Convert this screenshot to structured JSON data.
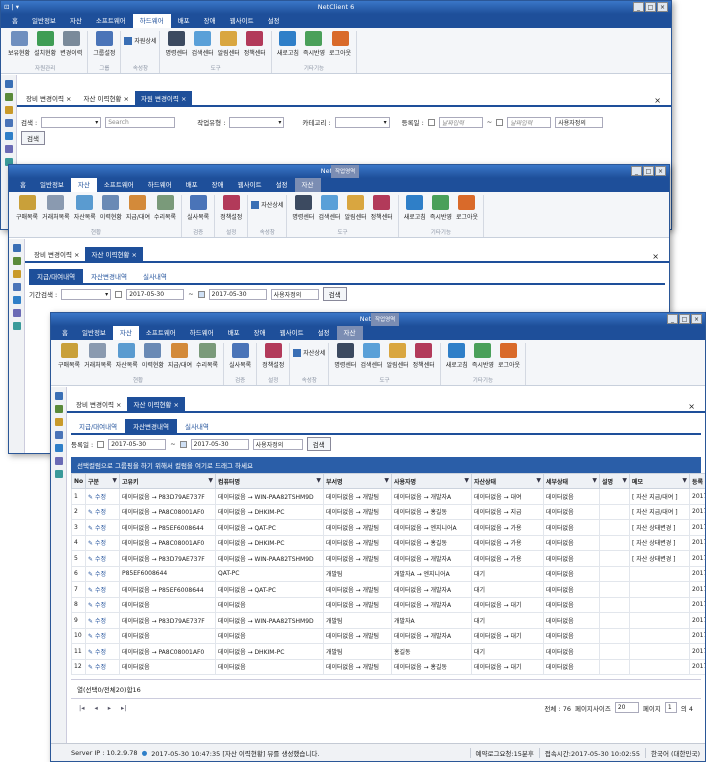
{
  "app": {
    "title": "NetClient 6",
    "context_tab": "작업영역",
    "context_sub": "자산",
    "quick_access": "⊡ | ▾",
    "ctrl_min": "_",
    "ctrl_max": "□",
    "ctrl_close": "×"
  },
  "menu": {
    "items": [
      "홈",
      "일반정보",
      "자산",
      "소프트웨어",
      "하드웨어",
      "배포",
      "장애",
      "웹사이트",
      "설정"
    ]
  },
  "ribbon_hw": {
    "groups": [
      {
        "label": "자원관리",
        "buttons": [
          {
            "label": "보유현황",
            "icon": "chart-icon",
            "color": "#6f8fbf"
          },
          {
            "label": "설치현황",
            "icon": "install-icon",
            "color": "#3f9d55"
          },
          {
            "label": "변경이력",
            "icon": "history-icon",
            "color": "#7a8a9a"
          }
        ]
      },
      {
        "label": "그룹",
        "buttons": [
          {
            "label": "그룹설정",
            "icon": "group-icon",
            "color": "#4a74b8"
          }
        ]
      },
      {
        "label": "속성창",
        "small": "자원상세"
      },
      {
        "label": "도구",
        "buttons": [
          {
            "label": "명령센터",
            "icon": "monitor-icon",
            "color": "#3c4a60"
          },
          {
            "label": "검색센터",
            "icon": "search-icon",
            "color": "#5aa0d8"
          },
          {
            "label": "알림센터",
            "icon": "bell-icon",
            "color": "#d9a640"
          },
          {
            "label": "정책센터",
            "icon": "policy-icon",
            "color": "#b23a5a"
          }
        ]
      },
      {
        "label": "기타기능",
        "buttons": [
          {
            "label": "새로고침",
            "icon": "refresh-icon",
            "color": "#2f7fc8"
          },
          {
            "label": "즉시반영",
            "icon": "apply-icon",
            "color": "#4aa05a"
          },
          {
            "label": "로그아웃",
            "icon": "logout-icon",
            "color": "#d96a2a"
          }
        ]
      }
    ]
  },
  "ribbon_asset": {
    "groups": [
      {
        "label": "현황",
        "buttons": [
          {
            "label": "구매목록",
            "icon": "purchase-icon",
            "color": "#c9a03a"
          },
          {
            "label": "거래처목록",
            "icon": "vendor-icon",
            "color": "#8a9ab0"
          },
          {
            "label": "자산목록",
            "icon": "asset-list-icon",
            "color": "#5a9bd0"
          },
          {
            "label": "이력현황",
            "icon": "history-icon",
            "color": "#6a8ab5"
          },
          {
            "label": "지급/대여",
            "icon": "lend-icon",
            "color": "#d38a3a"
          },
          {
            "label": "수리목록",
            "icon": "repair-icon",
            "color": "#7a9a7a"
          }
        ]
      },
      {
        "label": "검증",
        "buttons": [
          {
            "label": "실사목록",
            "icon": "audit-icon",
            "color": "#4a74b8"
          }
        ]
      },
      {
        "label": "설정",
        "buttons": [
          {
            "label": "정책설정",
            "icon": "policy-icon",
            "color": "#b23a5a"
          }
        ]
      },
      {
        "label": "속성창",
        "small": "자산상세"
      },
      {
        "label": "도구",
        "buttons": [
          {
            "label": "명령센터",
            "icon": "monitor-icon",
            "color": "#3c4a60"
          },
          {
            "label": "검색센터",
            "icon": "search-icon",
            "color": "#5aa0d8"
          },
          {
            "label": "알림센터",
            "icon": "bell-icon",
            "color": "#d9a640"
          },
          {
            "label": "정책센터",
            "icon": "policy-icon",
            "color": "#b23a5a"
          }
        ]
      },
      {
        "label": "기타기능",
        "buttons": [
          {
            "label": "새로고침",
            "icon": "refresh-icon",
            "color": "#2f7fc8"
          },
          {
            "label": "즉시반영",
            "icon": "apply-icon",
            "color": "#4aa05a"
          },
          {
            "label": "로그아웃",
            "icon": "logout-icon",
            "color": "#d96a2a"
          }
        ]
      }
    ]
  },
  "win1": {
    "doc_tabs": [
      "장비 변경이력 ×",
      "자산 이력현황 ×",
      "자원 변경이력 ×"
    ],
    "filter": {
      "search_label": "검색 :",
      "search_placeholder": "Search",
      "type_label": "작업유형 :",
      "category_label": "카테고리 :",
      "reg_label": "등록일 :",
      "date_placeholder": "날짜입력",
      "tilde": "~",
      "user_def": "사용자정의",
      "search_btn": "검색"
    }
  },
  "win2": {
    "doc_tabs": [
      "장비 변경이력 ×",
      "자산 이력현황 ×"
    ],
    "sub_tabs": [
      "지급/대여내역",
      "자산변경내역",
      "실사내역"
    ],
    "filter": {
      "label": "기간검색 :",
      "date_from": "2017-05-30",
      "date_to": "2017-05-30",
      "user_def": "사용자정의",
      "search_btn": "검색"
    }
  },
  "win3": {
    "doc_tabs": [
      "장비 변경이력 ×",
      "자산 이력현황 ×"
    ],
    "sub_tabs": [
      "지급/대여내역",
      "자산변경내역",
      "실사내역"
    ],
    "filter": {
      "label": "등록일 :",
      "date_from": "2017-05-30",
      "date_to": "2017-05-30",
      "user_def": "사용자정의",
      "search_btn": "검색"
    },
    "group_hint": "선택컬럼으로 그룹핑을 하기 위해서 컬럼을 여기로 드래그 하세요",
    "columns": [
      "No",
      "구분",
      "고유키",
      "컴퓨터명",
      "부서명",
      "사용자명",
      "자산상태",
      "세부상태",
      "설명",
      "메모",
      "등록"
    ],
    "rows": [
      [
        "1",
        "수정",
        "데이터없음 → P83D79AE737F",
        "데이터없음 → WIN-PAA82TSHM9D",
        "데이터없음 → 개발팀",
        "데이터없음 → 개발자A",
        "데이터없음 → 대여",
        "데이터없음",
        "",
        "[ 자산 지급/대여 ]",
        "2017"
      ],
      [
        "2",
        "수정",
        "데이터없음 → PA8C08001AF0",
        "데이터없음 → DHKIM-PC",
        "데이터없음 → 개발팀",
        "데이터없음 → 홍길동",
        "데이터없음 → 지급",
        "데이터없음",
        "",
        "[ 자산 지급/대여 ]",
        "2017"
      ],
      [
        "3",
        "수정",
        "데이터없음 → P85EF6008644",
        "데이터없음 → QAT-PC",
        "데이터없음 → 개발팀",
        "데이터없음 → 엔지니어A",
        "데이터없음 → 가용",
        "데이터없음",
        "",
        "[ 자산 상태변경 ]",
        "2017"
      ],
      [
        "4",
        "수정",
        "데이터없음 → PA8C08001AF0",
        "데이터없음 → DHKIM-PC",
        "데이터없음 → 개발팀",
        "데이터없음 → 홍길동",
        "데이터없음 → 가용",
        "데이터없음",
        "",
        "[ 자산 상태변경 ]",
        "2017"
      ],
      [
        "5",
        "수정",
        "데이터없음 → P83D79AE737F",
        "데이터없음 → WIN-PAA82TSHM9D",
        "데이터없음 → 개발팀",
        "데이터없음 → 개발자A",
        "데이터없음 → 가용",
        "데이터없음",
        "",
        "[ 자산 상태변경 ]",
        "2017"
      ],
      [
        "6",
        "수정",
        "P85EF6008644",
        "QAT-PC",
        "개발팀",
        "개발자A → 엔지니어A",
        "대기",
        "데이터없음",
        "",
        "",
        "2017"
      ],
      [
        "7",
        "수정",
        "데이터없음 → P85EF6008644",
        "데이터없음 → QAT-PC",
        "데이터없음 → 개발팀",
        "데이터없음 → 개발자A",
        "대기",
        "데이터없음",
        "",
        "",
        "2017"
      ],
      [
        "8",
        "수정",
        "데이터없음",
        "데이터없음",
        "데이터없음 → 개발팀",
        "데이터없음 → 개발자A",
        "데이터없음 → 대기",
        "데이터없음",
        "",
        "",
        "2017"
      ],
      [
        "9",
        "수정",
        "데이터없음 → P83D79AE737F",
        "데이터없음 → WIN-PAA82TSHM9D",
        "개발팀",
        "개발자A",
        "대기",
        "데이터없음",
        "",
        "",
        "2017"
      ],
      [
        "10",
        "수정",
        "데이터없음",
        "데이터없음",
        "데이터없음 → 개발팀",
        "데이터없음 → 개발자A",
        "데이터없음 → 대기",
        "데이터없음",
        "",
        "",
        "2017"
      ],
      [
        "11",
        "수정",
        "데이터없음 → PA8C08001AF0",
        "데이터없음 → DHKIM-PC",
        "개발팀",
        "홍길동",
        "대기",
        "데이터없음",
        "",
        "",
        "2017"
      ],
      [
        "12",
        "수정",
        "데이터없음",
        "데이터없음",
        "데이터없음 → 개발팀",
        "데이터없음 → 홍길동",
        "데이터없음 → 대기",
        "데이터없음",
        "",
        "",
        "2017"
      ]
    ],
    "footer_summary": "열(선택0/전체20)합16",
    "pager": {
      "total": "전체 : 76",
      "page_size_label": "페이지사이즈",
      "page_size": "20",
      "page_label": "페이지",
      "page": "1",
      "of": "의 4",
      "nav": [
        "|◂",
        "◂",
        "▸",
        "▸|"
      ]
    }
  },
  "status": {
    "server": "Server IP : 10.2.9.78",
    "msg": "2017-05-30 10:47:35  [자산 이력현황] 뷰를 생성했습니다.",
    "reserve": "예약로그요청:15분후",
    "access": "접속시간:2017-05-30 10:02:55",
    "lang": "한국어 (대한민국)"
  },
  "side_icons": [
    "home-icon",
    "user-icon",
    "asset-icon",
    "list-icon",
    "hardware-icon",
    "network-icon",
    "web-icon"
  ]
}
